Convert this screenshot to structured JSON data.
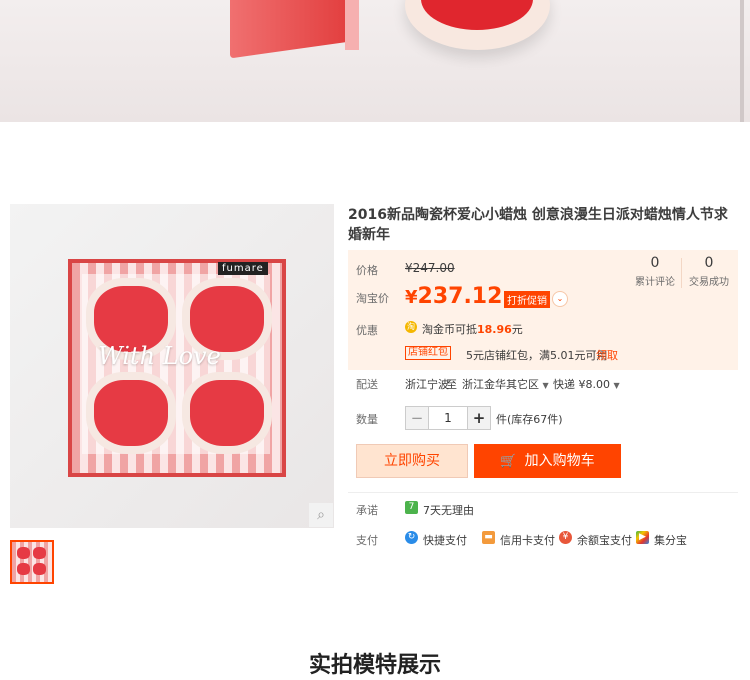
{
  "product": {
    "title": "2016新品陶瓷杯爱心小蜡烛 创意浪漫生日派对蜡烛情人节求婚新年",
    "brand": "fumare",
    "script_text": "With Love"
  },
  "price": {
    "label": "价格",
    "original": "¥247.00",
    "promo_label": "淘宝价",
    "currency": "¥",
    "current": "237.12",
    "promo_tag": "打折促销",
    "stats": [
      {
        "value": "0",
        "label": "累计评论"
      },
      {
        "value": "0",
        "label": "交易成功"
      }
    ]
  },
  "discount": {
    "label": "优惠",
    "coin_text": "淘金币可抵",
    "coin_amount": "18.96",
    "coin_unit": "元",
    "shop_tag": "店铺红包",
    "shop_text": "5元店铺红包，满5.01元可用",
    "get_label": "领取"
  },
  "shipping": {
    "label": "配送",
    "from": "浙江宁波",
    "to_word": "至",
    "to": "浙江金华其它区",
    "method": "快递 ¥8.00"
  },
  "quantity": {
    "label": "数量",
    "value": "1",
    "stock": "件(库存67件)"
  },
  "actions": {
    "buy_now": "立即购买",
    "add_cart": "加入购物车"
  },
  "promise": {
    "label": "承诺",
    "item": "7天无理由"
  },
  "payment": {
    "label": "支付",
    "items": [
      "快捷支付",
      "信用卡支付",
      "余额宝支付",
      "集分宝"
    ]
  },
  "section": {
    "heading": "实拍模特展示"
  },
  "colors": {
    "accent": "#ff4400",
    "price_bg": "#fff2e8"
  }
}
